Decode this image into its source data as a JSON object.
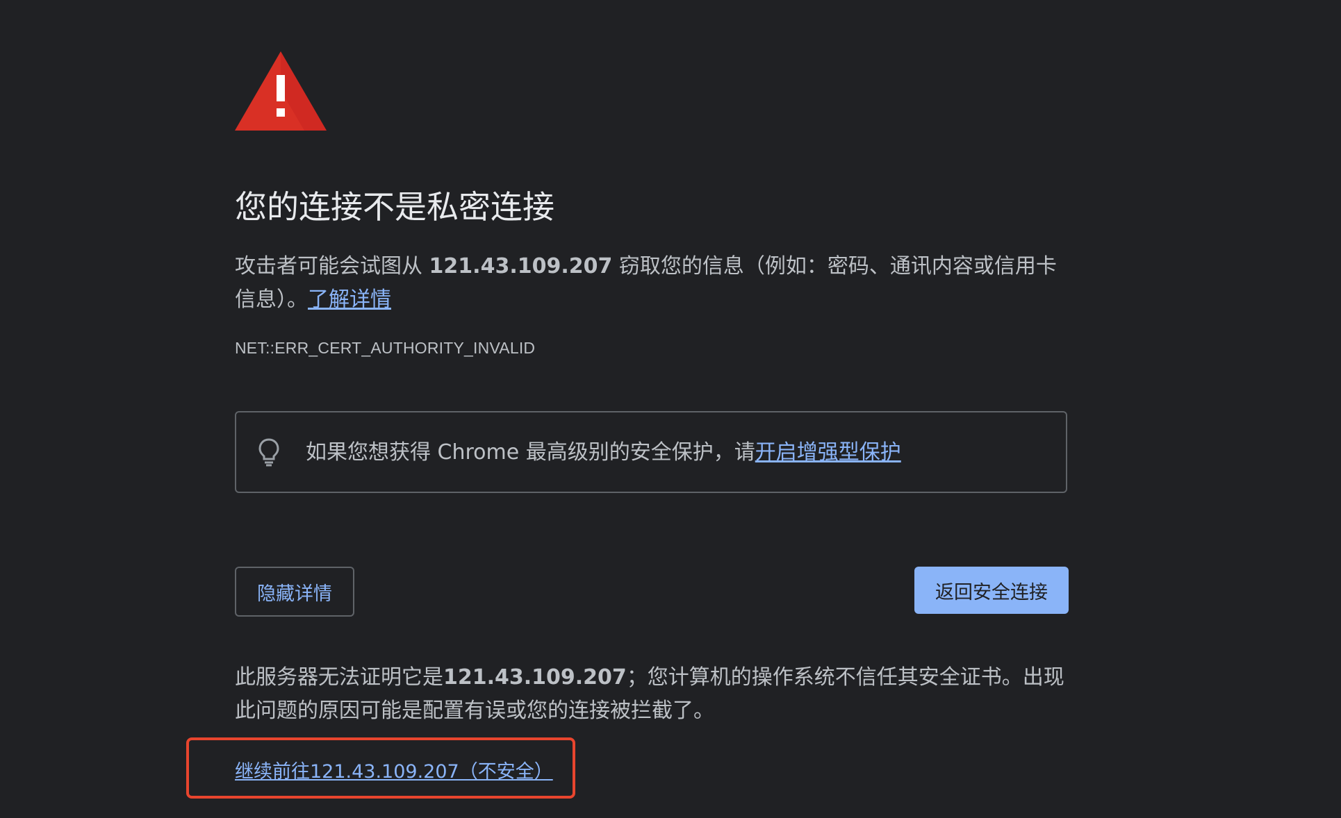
{
  "icons": {
    "warning": "warning-triangle-icon",
    "tip": "lightbulb-icon"
  },
  "colors": {
    "background": "#202124",
    "warning_red": "#d93025",
    "link_blue": "#8ab4f8",
    "annotation_red": "#e8452e"
  },
  "heading": "您的连接不是私密连接",
  "intro": {
    "before_host": "攻击者可能会试图从 ",
    "host": "121.43.109.207",
    "after_host": " 窃取您的信息（例如：密码、通讯内容或信用卡信息）。",
    "learn_more": "了解详情"
  },
  "error_code": "NET::ERR_CERT_AUTHORITY_INVALID",
  "tip": {
    "text": "如果您想获得 Chrome 最高级别的安全保护，请",
    "link": "开启增强型保护"
  },
  "buttons": {
    "hide_details": "隐藏详情",
    "back_to_safety": "返回安全连接"
  },
  "details": {
    "before_host": "此服务器无法证明它是",
    "host": "121.43.109.207",
    "after_host": "；您计算机的操作系统不信任其安全证书。出现此问题的原因可能是配置有误或您的连接被拦截了。"
  },
  "proceed_link": "继续前往121.43.109.207（不安全）"
}
